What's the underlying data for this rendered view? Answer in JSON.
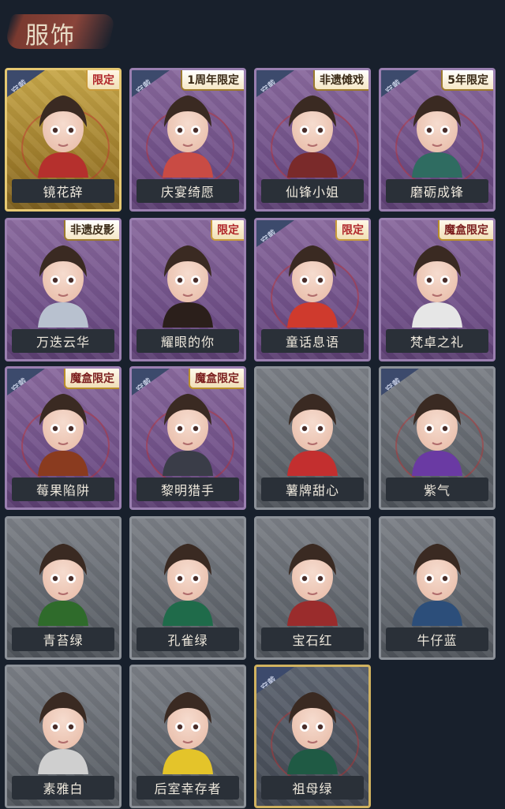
{
  "header": {
    "title": "服饰"
  },
  "tags": {
    "wear": "穿戴"
  },
  "items": [
    {
      "name": "镜花辞",
      "badge": "限定",
      "wear": true,
      "frame": "gold",
      "icon": "character-red-hood-icon",
      "accent": "#b5302d"
    },
    {
      "name": "庆宴绮愿",
      "badge": "1周年限定",
      "wear": true,
      "frame": "purple",
      "icon": "character-cake-girl-icon",
      "accent": "#c94b44"
    },
    {
      "name": "仙锋小姐",
      "badge": "非遗傩戏",
      "wear": true,
      "frame": "purple",
      "icon": "character-mask-icon",
      "accent": "#7a2a2a"
    },
    {
      "name": "磨砺成锋",
      "badge": "5年限定",
      "wear": true,
      "frame": "purple",
      "icon": "character-green-blade-icon",
      "accent": "#2f6c61"
    },
    {
      "name": "万迭云华",
      "badge": "非遗皮影",
      "wear": false,
      "frame": "purple",
      "icon": "character-silver-hair-icon",
      "accent": "#b8c1cf"
    },
    {
      "name": "耀眼的你",
      "badge": "限定",
      "wear": false,
      "frame": "purple",
      "icon": "character-cowboy-hat-icon",
      "accent": "#2b1f1b"
    },
    {
      "name": "童话息语",
      "badge": "限定",
      "wear": true,
      "frame": "purple",
      "icon": "character-mushroom-hat-icon",
      "accent": "#cf3a2d"
    },
    {
      "name": "梵卓之礼",
      "badge": "魔盒限定",
      "wear": false,
      "frame": "purple",
      "icon": "character-white-hair-icon",
      "accent": "#e6e6e6"
    },
    {
      "name": "莓果陷阱",
      "badge": "魔盒限定",
      "wear": true,
      "frame": "purple",
      "icon": "character-hooded-blindfold-icon",
      "accent": "#8a3b1f"
    },
    {
      "name": "黎明猎手",
      "badge": "魔盒限定",
      "wear": true,
      "frame": "purple",
      "icon": "character-hunter-icon",
      "accent": "#3a3d48"
    },
    {
      "name": "薯牌甜心",
      "badge": "",
      "wear": false,
      "frame": "gray",
      "icon": "character-snake-hat-icon",
      "accent": "#c32f2f"
    },
    {
      "name": "紫气",
      "badge": "",
      "wear": true,
      "frame": "gray",
      "icon": "character-purple-shirt-icon",
      "accent": "#6a3aa3"
    },
    {
      "name": "青苔绿",
      "badge": "",
      "wear": false,
      "frame": "gray",
      "icon": "character-green-hoodie-icon",
      "accent": "#2f6b2b"
    },
    {
      "name": "孔雀绿",
      "badge": "",
      "wear": false,
      "frame": "gray",
      "icon": "character-green-hoodie-icon",
      "accent": "#1f6b4a"
    },
    {
      "name": "宝石红",
      "badge": "",
      "wear": false,
      "frame": "gray",
      "icon": "character-red-hoodie-icon",
      "accent": "#9a2c2c"
    },
    {
      "name": "牛仔蓝",
      "badge": "",
      "wear": false,
      "frame": "gray",
      "icon": "character-blue-hoodie-icon",
      "accent": "#2c4e7a"
    },
    {
      "name": "素雅白",
      "badge": "",
      "wear": false,
      "frame": "gray",
      "icon": "character-white-hoodie-icon",
      "accent": "#cfcfcf"
    },
    {
      "name": "后室幸存者",
      "badge": "",
      "wear": false,
      "frame": "gray",
      "icon": "character-hazmat-icon",
      "accent": "#e4c42a"
    },
    {
      "name": "祖母绿",
      "badge": "",
      "wear": true,
      "frame": "purplegold",
      "icon": "character-silver-hair-green-icon",
      "accent": "#1f5a44"
    }
  ]
}
